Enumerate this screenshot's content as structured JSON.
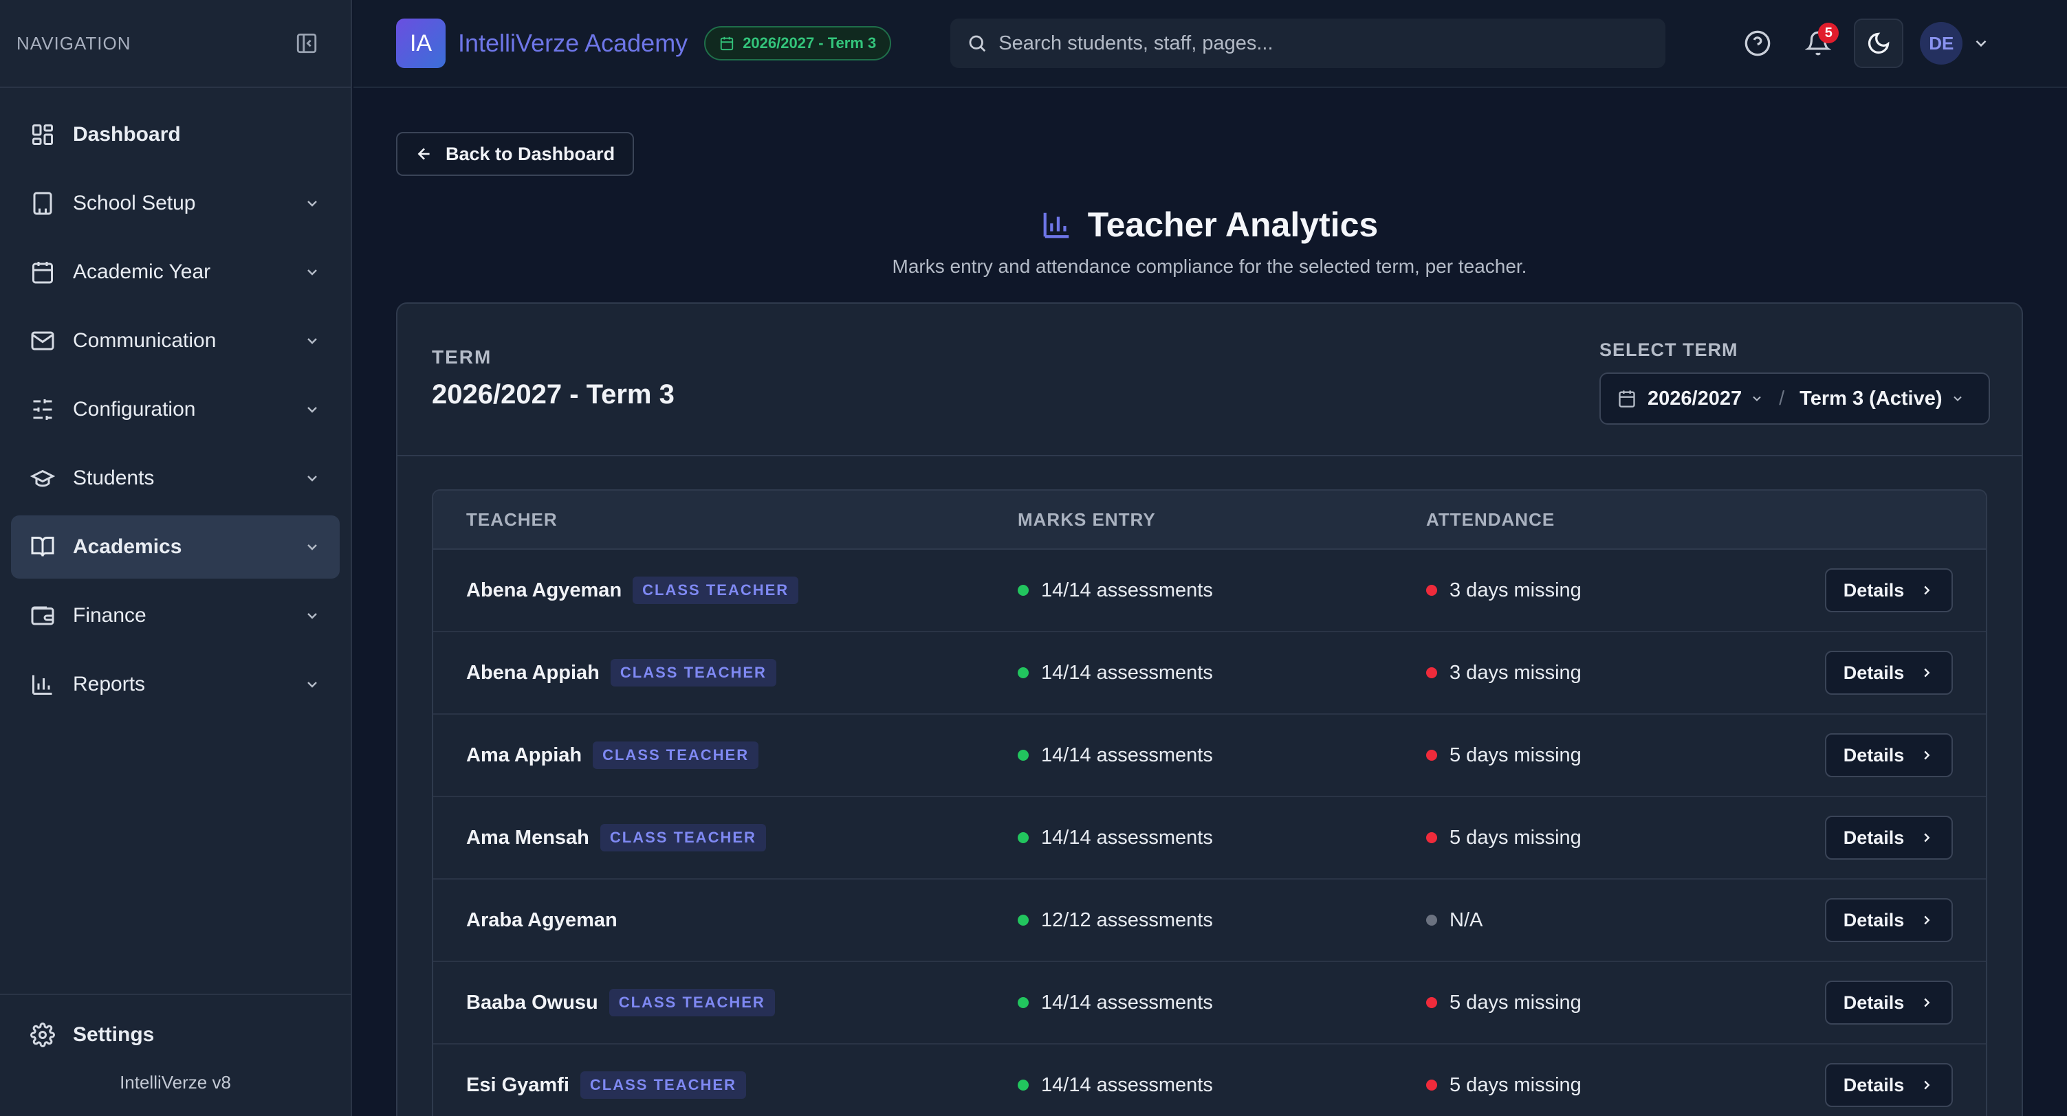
{
  "sidebar": {
    "heading": "NAVIGATION",
    "items": [
      {
        "label": "Dashboard",
        "icon": "dashboard-icon",
        "has_chevron": false
      },
      {
        "label": "School Setup",
        "icon": "building-icon",
        "has_chevron": true
      },
      {
        "label": "Academic Year",
        "icon": "calendar-icon",
        "has_chevron": true
      },
      {
        "label": "Communication",
        "icon": "mail-icon",
        "has_chevron": true
      },
      {
        "label": "Configuration",
        "icon": "sliders-icon",
        "has_chevron": true
      },
      {
        "label": "Students",
        "icon": "graduation-cap-icon",
        "has_chevron": true
      },
      {
        "label": "Academics",
        "icon": "book-open-icon",
        "has_chevron": true,
        "active": true
      },
      {
        "label": "Finance",
        "icon": "wallet-icon",
        "has_chevron": true
      },
      {
        "label": "Reports",
        "icon": "bar-chart-icon",
        "has_chevron": true
      }
    ],
    "settings_label": "Settings",
    "version": "IntelliVerze v8"
  },
  "header": {
    "logo_text": "IA",
    "app_title": "IntelliVerze Academy",
    "term_pill": "2026/2027 - Term 3",
    "search_placeholder": "Search students, staff, pages...",
    "notifications_count": "5",
    "avatar_initials": "DE"
  },
  "page": {
    "back_label": "Back to Dashboard",
    "title": "Teacher Analytics",
    "subtitle": "Marks entry and attendance compliance for the selected term, per teacher."
  },
  "card": {
    "term_label": "TERM",
    "term_value": "2026/2027 - Term 3",
    "select_label": "SELECT TERM",
    "year_option": "2026/2027",
    "term_option": "Term 3 (Active)"
  },
  "table": {
    "columns": [
      "TEACHER",
      "MARKS ENTRY",
      "ATTENDANCE"
    ],
    "details_label": "Details",
    "rows": [
      {
        "name": "Abena Agyeman",
        "tag": "CLASS TEACHER",
        "marks": "14/14 assessments",
        "marks_status": "g",
        "attendance": "3 days missing",
        "att_status": "r"
      },
      {
        "name": "Abena Appiah",
        "tag": "CLASS TEACHER",
        "marks": "14/14 assessments",
        "marks_status": "g",
        "attendance": "3 days missing",
        "att_status": "r"
      },
      {
        "name": "Ama Appiah",
        "tag": "CLASS TEACHER",
        "marks": "14/14 assessments",
        "marks_status": "g",
        "attendance": "5 days missing",
        "att_status": "r"
      },
      {
        "name": "Ama Mensah",
        "tag": "CLASS TEACHER",
        "marks": "14/14 assessments",
        "marks_status": "g",
        "attendance": "5 days missing",
        "att_status": "r"
      },
      {
        "name": "Araba Agyeman",
        "tag": "",
        "marks": "12/12 assessments",
        "marks_status": "g",
        "attendance": "N/A",
        "att_status": "n"
      },
      {
        "name": "Baaba Owusu",
        "tag": "CLASS TEACHER",
        "marks": "14/14 assessments",
        "marks_status": "g",
        "attendance": "5 days missing",
        "att_status": "r"
      },
      {
        "name": "Esi Gyamfi",
        "tag": "CLASS TEACHER",
        "marks": "14/14 assessments",
        "marks_status": "g",
        "attendance": "5 days missing",
        "att_status": "r"
      }
    ]
  },
  "colors": {
    "accent": "#6e76e8",
    "success": "#22c55e",
    "danger": "#ef2b3b"
  }
}
